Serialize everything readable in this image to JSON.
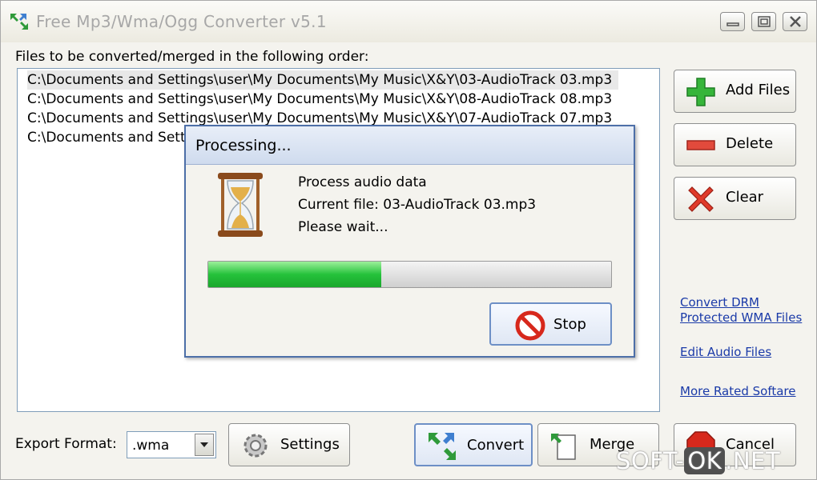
{
  "window": {
    "title": "Free Mp3/Wma/Ogg Converter v5.1",
    "controls": [
      "minimize-icon",
      "maximize-icon",
      "close-icon"
    ]
  },
  "files_label": "Files to be converted/merged in the following order:",
  "files": [
    "C:\\Documents and Settings\\user\\My Documents\\My Music\\X&Y\\03-AudioTrack 03.mp3",
    "C:\\Documents and Settings\\user\\My Documents\\My Music\\X&Y\\08-AudioTrack 08.mp3",
    "C:\\Documents and Settings\\user\\My Documents\\My Music\\X&Y\\07-AudioTrack 07.mp3",
    "C:\\Documents and Setti"
  ],
  "sidebar": {
    "add_files": "Add Files",
    "delete": "Delete",
    "clear": "Clear"
  },
  "links": {
    "drm_line1": "Convert DRM",
    "drm_line2": "Protected WMA Files",
    "edit_audio": "Edit Audio Files",
    "more_rated": "More Rated Softare"
  },
  "bottom": {
    "export_label": "Export Format:",
    "export_value": ".wma",
    "settings": "Settings",
    "convert": "Convert",
    "merge": "Merge",
    "cancel": "Cancel"
  },
  "dialog": {
    "title": "Processing...",
    "line1": "Process audio data",
    "line2": "Current file: 03-AudioTrack 03.mp3",
    "line3": "Please wait...",
    "progress": 0.43,
    "stop": "Stop"
  },
  "watermark": {
    "part1": "SOFT-",
    "part2": "OK",
    "part3": ".NET"
  },
  "colors": {
    "link": "#1a3aa8",
    "progress_fill": "#25c23b",
    "dialog_border": "#4d6fa8"
  }
}
